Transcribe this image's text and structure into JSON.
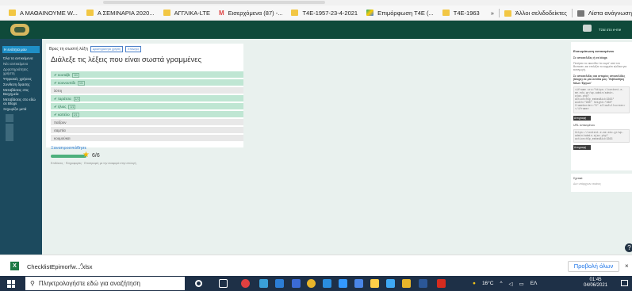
{
  "browser": {
    "bookmarks": [
      {
        "label": "Α ΜΑΘΑΙΝΟΥΜΕ W...",
        "icon": "folder-icon"
      },
      {
        "label": "Α ΣΕΜΙΝΑΡΙΑ 2020...",
        "icon": "folder-icon"
      },
      {
        "label": "ΑΓΓΛΙΚΑ-LTE",
        "icon": "folder-icon"
      },
      {
        "label": "Εισερχόμενα (87) -...",
        "icon": "gmail-icon"
      },
      {
        "label": "Τ4Ε-1957-23-4-2021",
        "icon": "folder-icon"
      },
      {
        "label": "Επιμόρφωση Τ4Ε (...",
        "icon": "drive-icon"
      },
      {
        "label": "Τ4Ε-1963",
        "icon": "folder-icon"
      }
    ],
    "more": "»",
    "other_bookmarks": "Άλλοι σελιδοδείκτες",
    "reading_list": "Λίστα ανάγνωση"
  },
  "sidebar": {
    "current": "Η ενότητα μου",
    "items": [
      "Όλα τα αντικείμενα",
      "Νέο αντικείμενο",
      "Δραστηριότητες χρήστη",
      "Ψηφιακές χρήσεις",
      "Συνθεση δρασης",
      "Μεταβάσεις στις Βιοχημεία",
      "Μεταβάσεις στο εδώ σε Blogs",
      "Ξεχωρίζει μετά"
    ]
  },
  "quiz": {
    "tab_title": "Βρες τη σωστή λέξη",
    "tab_btn1": "Δραστηριότητα χρήστη",
    "tab_btn2": "Επιλογές",
    "question": "Διάλεξε τις λέξεις που είναι σωστά γραμμένες",
    "options": [
      {
        "text": "κουτάβι",
        "status": "correct",
        "score": "1/1"
      },
      {
        "text": "κουνουπίδι",
        "status": "correct",
        "score": "1/1"
      },
      {
        "text": "λύπη",
        "status": "neutral",
        "score": ""
      },
      {
        "text": "ταράτσα",
        "status": "correct",
        "score": "1/1"
      },
      {
        "text": "ήλιος",
        "status": "correct",
        "score": "1/1"
      },
      {
        "text": "καπέλο",
        "status": "correct",
        "score": "1/1"
      },
      {
        "text": "παίζουν",
        "status": "neutral",
        "score": ""
      },
      {
        "text": "σαμπία",
        "status": "neutral",
        "score": ""
      },
      {
        "text": "κουμούκαι",
        "status": "neutral",
        "score": ""
      }
    ],
    "retry": "Ξαναπροσπάθησε",
    "score_display": "6/6",
    "score_fraction": 1.0,
    "meta": "Επιδόσεις · Πληροφορίες · Επιστροφές με την αναφορά στην επιλογή"
  },
  "rpanel": {
    "title": "Ενσωμάτωση αντικειμένου",
    "subtitle": "Σε ιστοσελίδες ή σε blogs",
    "desc": "Πατήστε το εικονίδιο 'σε ευρύ' από τον Browser, και επιλέξτε το κομμάτι κώδικα για εισαγωγή.",
    "sub2": "Σε ιστοσελίδες και ιστορίες ιστοσελίδες (blogs) σε μία σελίδα μας: 'Βιβλιοθήκη Νέων Έργων'",
    "code": "<iframe src=\"https://content.e-me.edu.gr/wp-admin/admin-ajax.php?action=h5p_embed&id=3363\" width=\"960\" height=\"468\" frameborder=\"0\" allowfullscreen></iframe>",
    "copy_btn": "Αντιγραφή",
    "url_label": "URL αντικειμένου",
    "url": "https://content.e-me.edu.gr/wp-admin/admin-ajax.php?action=h5p_embed&id=3363",
    "copy_btn2": "Αντιγραφή"
  },
  "rpanel2": {
    "title": "Σχετικά",
    "desc": "Δεν υπάρχουν ετικέτες"
  },
  "download": {
    "filename": "ChecklistEpimorfw....xlsx",
    "show_all": "Προβολή όλων",
    "close": "×"
  },
  "taskbar": {
    "search_placeholder": "Πληκτρολογήστε εδώ για αναζήτηση",
    "weather": "16°C",
    "lang": "ΕΛ",
    "time": "01:45",
    "date": "04/06/2021"
  }
}
